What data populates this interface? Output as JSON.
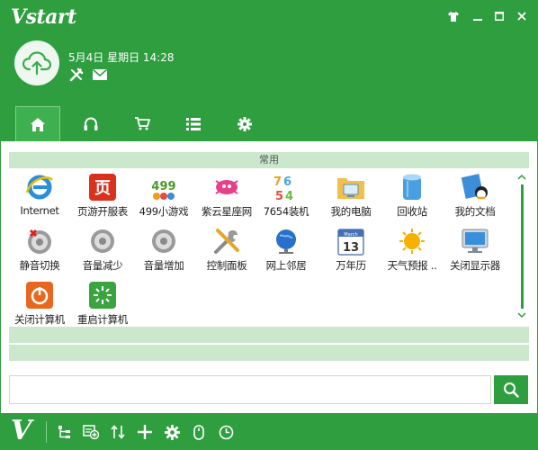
{
  "app": {
    "logo": "Vstart",
    "footer_logo": "V"
  },
  "header": {
    "datetime": "5月4日 星期日 14:28"
  },
  "category": {
    "title": "常用"
  },
  "apps": [
    {
      "label": "Internet",
      "icon": "ie-icon"
    },
    {
      "label": "页游开服表",
      "icon": "webgame-icon"
    },
    {
      "label": "499小游戏",
      "icon": "game499-icon"
    },
    {
      "label": "紫云星座网",
      "icon": "zodiac-icon"
    },
    {
      "label": "7654装机",
      "icon": "install7654-icon"
    },
    {
      "label": "我的电脑",
      "icon": "my-computer-icon"
    },
    {
      "label": "回收站",
      "icon": "recycle-bin-icon"
    },
    {
      "label": "我的文档",
      "icon": "my-documents-icon"
    },
    {
      "label": "静音切换",
      "icon": "mute-toggle-icon"
    },
    {
      "label": "音量减少",
      "icon": "volume-down-icon"
    },
    {
      "label": "音量增加",
      "icon": "volume-up-icon"
    },
    {
      "label": "控制面板",
      "icon": "control-panel-icon"
    },
    {
      "label": "网上邻居",
      "icon": "network-icon"
    },
    {
      "label": "万年历",
      "icon": "calendar-icon"
    },
    {
      "label": "天气预报 ..",
      "icon": "weather-icon"
    },
    {
      "label": "关闭显示器",
      "icon": "monitor-off-icon"
    },
    {
      "label": "关闭计算机",
      "icon": "shutdown-icon"
    },
    {
      "label": "重启计算机",
      "icon": "restart-icon"
    }
  ],
  "calendar_icon": {
    "month": "March",
    "day": "13"
  },
  "game_icon": {
    "text": "499"
  },
  "search": {
    "value": "",
    "placeholder": ""
  },
  "colors": {
    "brand": "#2e9e3f",
    "light": "#cbe8cd"
  }
}
